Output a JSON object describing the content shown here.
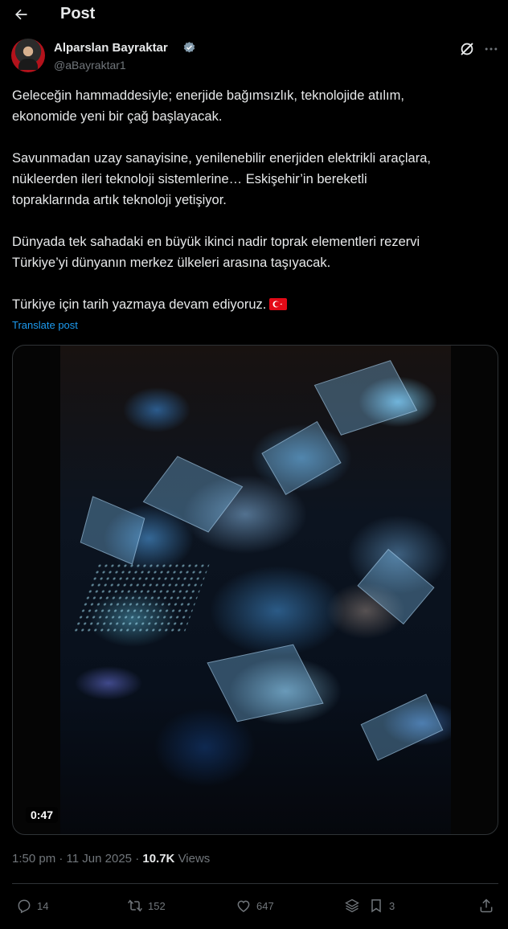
{
  "header": {
    "title": "Post",
    "back_icon": "arrow-left-icon"
  },
  "author": {
    "name": "Alparslan Bayraktar",
    "handle": "@aBayraktar1",
    "verified_icon": "verified-badge-icon",
    "verified_color": "#829aab"
  },
  "post": {
    "paragraphs": [
      "Geleceğin hammaddesiyle; enerjide bağımsızlık, teknolojide atılım,\nekonomide yeni bir çağ başlayacak.",
      "Savunmadan uzay sanayisine, yenilenebilir enerjiden elektrikli araçlara,\nnükleerden ileri teknoloji sistemlerine… Eskişehir’in bereketli\ntopraklarında artık teknoloji yetişiyor.",
      "Dünyada tek sahadaki en büyük ikinci nadir toprak elementleri rezervi\nTürkiye’yi dünyanın merkez ülkeleri arasına taşıyacak.",
      "Türkiye için tarih yazmaya devam ediyoruz."
    ],
    "flag_icon": "turkey-flag-icon",
    "translate_label": "Translate post",
    "video_duration": "0:47"
  },
  "meta": {
    "time": "1:50 pm",
    "separator": "·",
    "date": "11 Jun 2025",
    "views_count": "10.7K",
    "views_label": "Views"
  },
  "actions": {
    "replies": "14",
    "reposts": "152",
    "likes": "647",
    "bookmarks": "3"
  },
  "colors": {
    "background": "#000000",
    "text": "#e7e9ea",
    "secondary": "#71767b",
    "link": "#1d9bf0",
    "border": "#2f3336",
    "flag_red": "#e30a17"
  }
}
